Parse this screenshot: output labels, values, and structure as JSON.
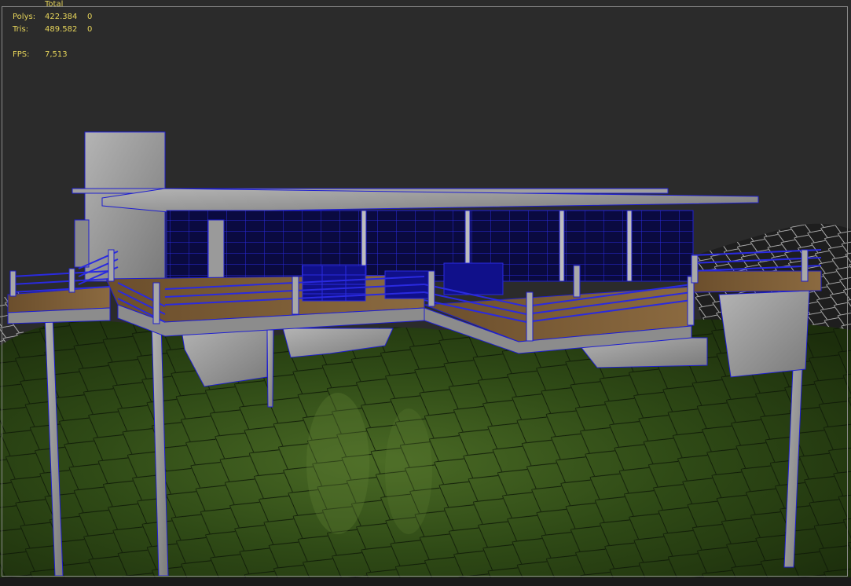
{
  "viewport_stats": {
    "header": "Total",
    "polys_label": "Polys:",
    "polys_total": "422.384",
    "polys_selected": "0",
    "tris_label": "Tris:",
    "tris_total": "489.582",
    "tris_selected": "0",
    "fps_label": "FPS:",
    "fps_value": "7,513"
  },
  "colors": {
    "viewport_bg": "#2b2b2b",
    "stats_text": "#e6d45a",
    "wire_blue": "#1f1fd0",
    "terrain_green": "#2f4a16",
    "concrete": "#9a9a9a",
    "deck_wood": "#7a5a33"
  }
}
